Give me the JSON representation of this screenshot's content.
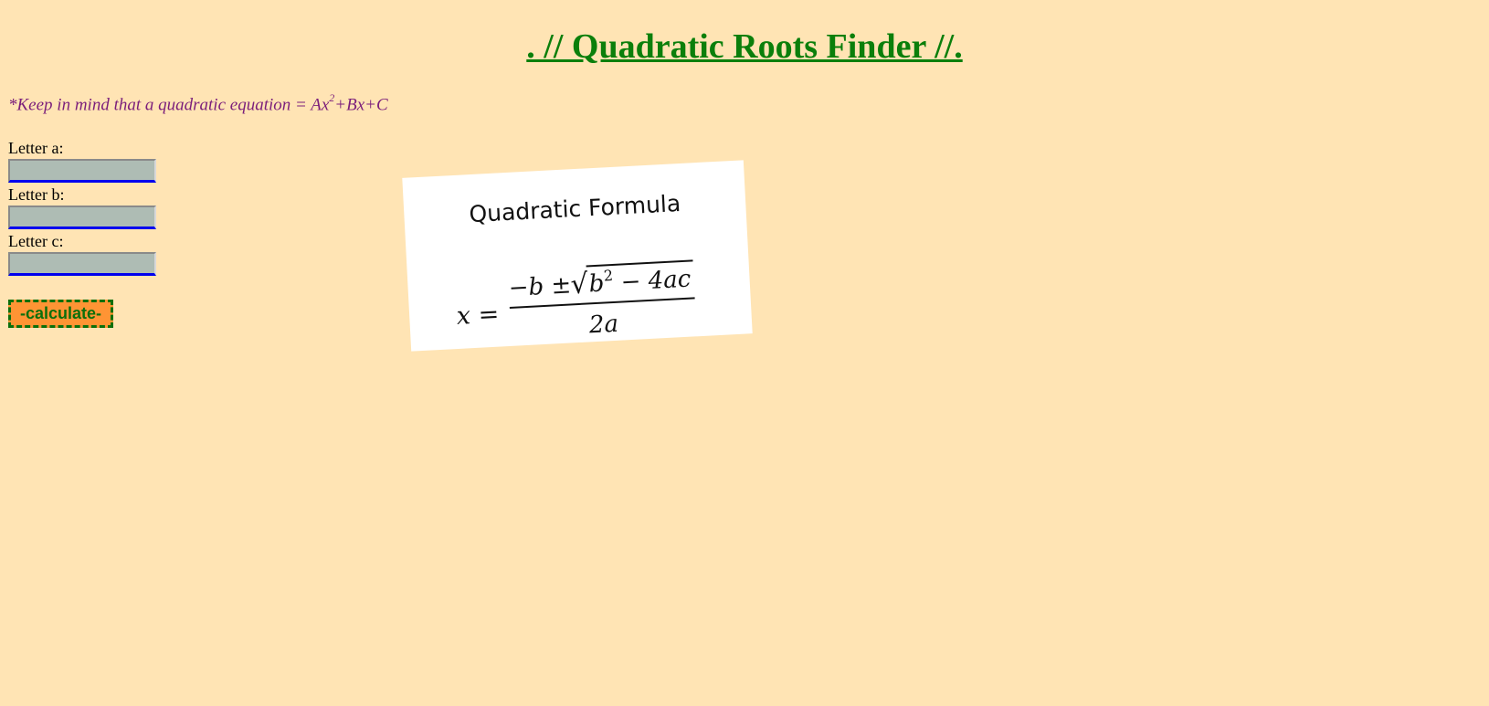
{
  "page": {
    "title": ". // Quadratic Roots Finder //.",
    "hint_prefix": "*Keep in mind that a quadratic equation = Ax",
    "hint_sup": "2",
    "hint_suffix": "+Bx+C"
  },
  "form": {
    "label_a": "Letter a:",
    "label_b": "Letter b:",
    "label_c": "Letter c:",
    "value_a": "",
    "value_b": "",
    "value_c": "",
    "calculate_label": "-calculate-"
  },
  "formula_image": {
    "heading": "Quadratic Formula",
    "lhs": "x =",
    "numerator_prefix": "−b ±",
    "radical_sign": "√",
    "radicand_b": "b",
    "radicand_exp": "2",
    "radicand_rest": " − 4ac",
    "denominator": "2a"
  },
  "colors": {
    "background": "#ffe4b4",
    "title": "#0b7f0b",
    "hint": "#7b1f7b",
    "button_fill": "#ff9434",
    "button_border": "#0b6f0b",
    "field_fill": "#aebcb4",
    "field_underline": "#0000ee"
  }
}
